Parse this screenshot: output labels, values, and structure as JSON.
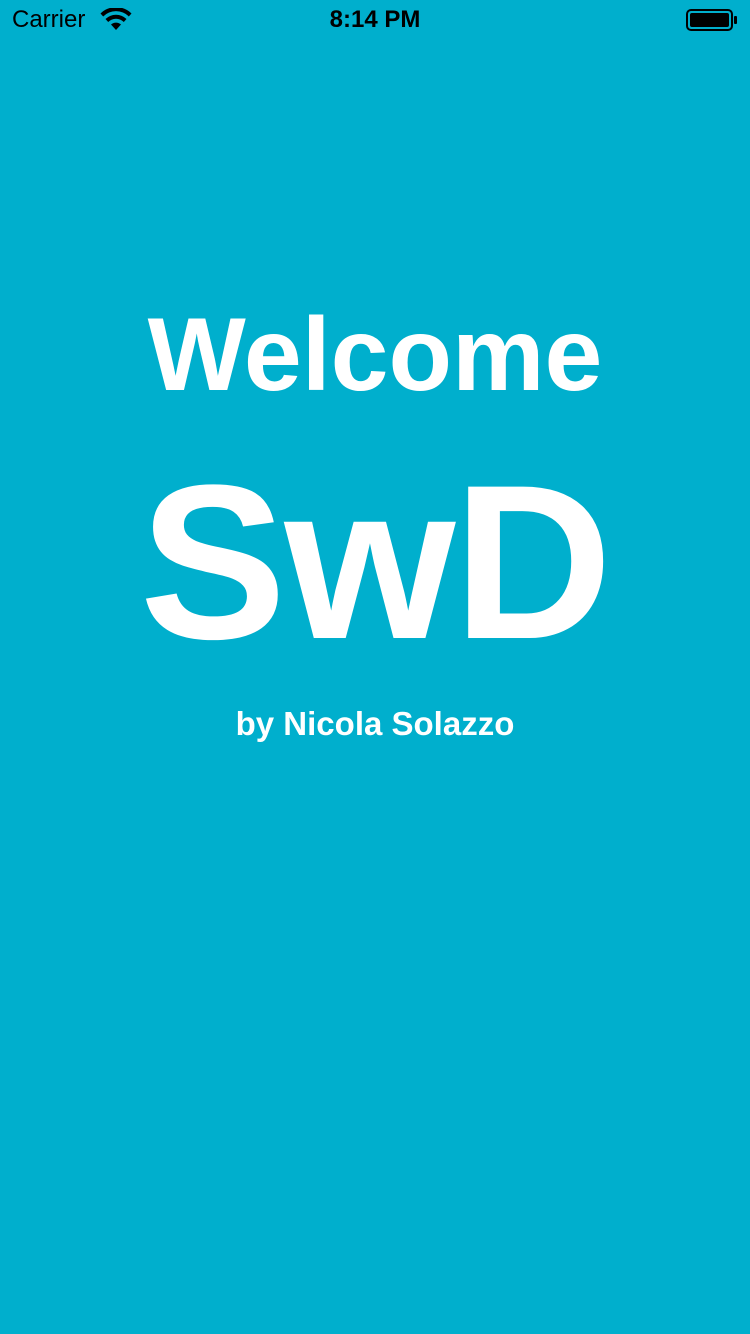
{
  "status_bar": {
    "carrier": "Carrier",
    "time": "8:14 PM",
    "wifi_icon": "wifi-icon",
    "battery_icon": "battery-icon"
  },
  "main": {
    "welcome": "Welcome",
    "logo": "SwD",
    "byline": "by Nicola Solazzo"
  },
  "colors": {
    "background": "#00AFCD",
    "text": "#FFFFFF",
    "status_text": "#000000"
  }
}
